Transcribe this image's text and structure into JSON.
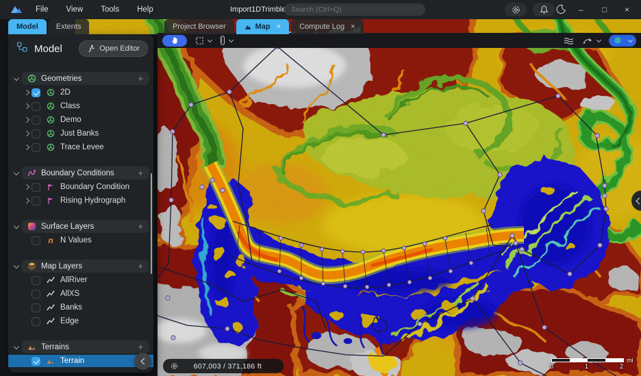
{
  "titlebar": {
    "menus": [
      "File",
      "View",
      "Tools",
      "Help"
    ],
    "title": "Import1DTrimble",
    "search_placeholder": "Search (Ctrl+Q)",
    "minimize_glyph": "–",
    "maximize_glyph": "□",
    "close_glyph": "×"
  },
  "icons": {
    "app_logo": "mountain-logo",
    "settings": "gear",
    "notifications": "bell",
    "theme_toggle": "moon",
    "pan_tool": "hand",
    "select_tool": "dashed-rectangle",
    "measure_tool": "ruler",
    "flow_tool": "waves",
    "profile_tool": "curved-arrow",
    "basemap": "globe",
    "sidebar_collapse": "chevron-left",
    "right_panel_collapse": "chevron-left"
  },
  "sidebar": {
    "tabs": [
      {
        "label": "Model",
        "active": true
      },
      {
        "label": "Extents",
        "active": false
      }
    ],
    "panel_title": "Model",
    "open_editor_label": "Open Editor",
    "sections": [
      {
        "label": "Geometries",
        "icon": "geometry-wheel",
        "items": [
          {
            "label": "2D",
            "checked": true
          },
          {
            "label": "Class",
            "checked": false
          },
          {
            "label": "Demo",
            "checked": false
          },
          {
            "label": "Just Banks",
            "checked": false
          },
          {
            "label": "Trace Levee",
            "checked": false
          }
        ]
      },
      {
        "label": "Boundary Conditions",
        "icon": "boundary-curve",
        "items": [
          {
            "label": "Boundary Condition",
            "checked": false
          },
          {
            "label": "Rising Hydrograph",
            "checked": false
          }
        ]
      },
      {
        "label": "Surface Layers",
        "icon": "surface-swatch",
        "items": [
          {
            "label": "N Values",
            "checked": false
          }
        ]
      },
      {
        "label": "Map Layers",
        "icon": "layer-stack",
        "items": [
          {
            "label": "AllRiver",
            "checked": false
          },
          {
            "label": "AllXS",
            "checked": false
          },
          {
            "label": "Banks",
            "checked": false
          },
          {
            "label": "Edge",
            "checked": false
          }
        ]
      },
      {
        "label": "Terrains",
        "icon": "mountains",
        "items": [
          {
            "label": "Terrain",
            "checked": true,
            "selected": true
          }
        ]
      }
    ]
  },
  "main": {
    "tabs": [
      {
        "label": "Project Browser",
        "active": false,
        "closable": false
      },
      {
        "label": "Map",
        "active": true,
        "closable": true
      },
      {
        "label": "Compute Log",
        "active": false,
        "closable": true
      }
    ]
  },
  "map": {
    "coordinates": "607,003  /  371,186 ft",
    "scale_ticks": [
      "0",
      "1",
      "2"
    ],
    "scale_unit": "mi"
  },
  "colors": {
    "accent_blue": "#3ba3ec",
    "tab_active_blue": "#47b5f2",
    "selected_row_blue": "#1b6fae",
    "toolbar_button_blue": "#3d6cea",
    "terrain_low_flood_blue": "#1b18dc",
    "terrain_yellow": "#e2b90c",
    "terrain_high_dark_red": "#971a0e",
    "terrain_gray_peaks": "#c9c9c9",
    "channel_orange": "#ff9100",
    "river_green": "#2da32b",
    "boundary_line_navy": "#1c1c3e",
    "vertex_dot_purple": "#cdb8f0"
  }
}
